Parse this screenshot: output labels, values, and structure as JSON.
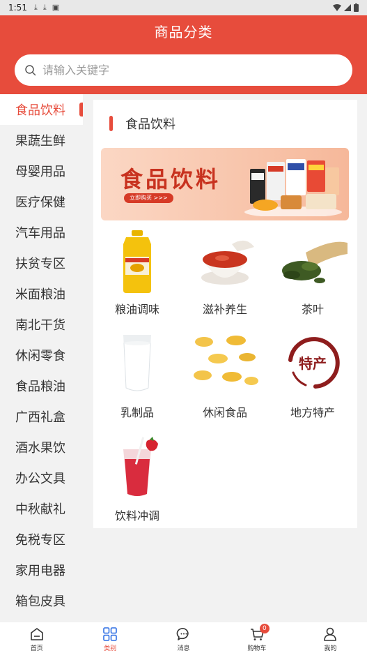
{
  "status_bar": {
    "time": "1:51"
  },
  "header": {
    "title": "商品分类"
  },
  "search": {
    "placeholder": "请输入关键字"
  },
  "sidebar": {
    "items": [
      {
        "label": "食品饮料",
        "active": true
      },
      {
        "label": "果蔬生鲜"
      },
      {
        "label": "母婴用品"
      },
      {
        "label": "医疗保健"
      },
      {
        "label": "汽车用品"
      },
      {
        "label": "扶贫专区"
      },
      {
        "label": "米面粮油"
      },
      {
        "label": "南北干货"
      },
      {
        "label": "休闲零食"
      },
      {
        "label": "食品粮油"
      },
      {
        "label": "广西礼盒"
      },
      {
        "label": "酒水果饮"
      },
      {
        "label": "办公文具"
      },
      {
        "label": "中秋献礼"
      },
      {
        "label": "免税专区"
      },
      {
        "label": "家用电器"
      },
      {
        "label": "箱包皮具"
      }
    ]
  },
  "panel": {
    "title": "食品饮料",
    "banner": {
      "title": "食品饮料",
      "button": "立即购买 >>>"
    },
    "items": [
      {
        "label": "粮油调味",
        "icon": "oil-bottle"
      },
      {
        "label": "滋补养生",
        "icon": "soup-bowl"
      },
      {
        "label": "茶叶",
        "icon": "tea-leaves"
      },
      {
        "label": "乳制品",
        "icon": "milk-glass"
      },
      {
        "label": "休闲食品",
        "icon": "potato-chips"
      },
      {
        "label": "地方特产",
        "icon": "specialty-seal"
      },
      {
        "label": "饮料冲调",
        "icon": "drink-cup"
      }
    ],
    "seal_text": "特产"
  },
  "tabbar": {
    "items": [
      {
        "label": "首页",
        "icon": "home-icon"
      },
      {
        "label": "类别",
        "icon": "category-icon",
        "active": true
      },
      {
        "label": "消息",
        "icon": "message-icon"
      },
      {
        "label": "购物车",
        "icon": "cart-icon",
        "badge": "0"
      },
      {
        "label": "我的",
        "icon": "profile-icon"
      }
    ]
  },
  "colors": {
    "brand": "#e74c3c",
    "background": "#f2f2f2"
  }
}
